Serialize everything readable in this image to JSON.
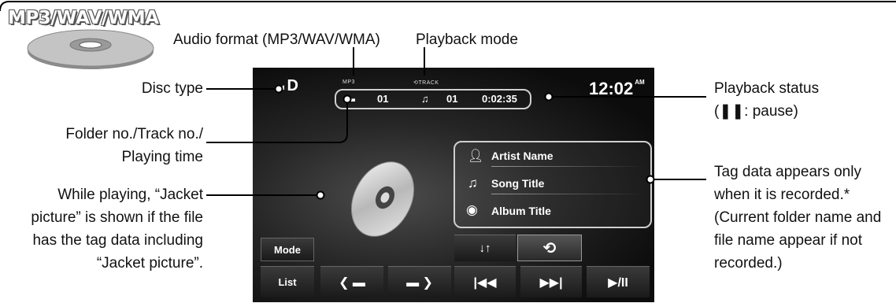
{
  "header": {
    "format_title": "MP3/WAV/WMA"
  },
  "callouts": {
    "audio_format": "Audio format (MP3/WAV/WMA)",
    "playback_mode": "Playback mode",
    "disc_type": "Disc type",
    "folder_track_1": "Folder no./Track no./",
    "folder_track_2": "Playing time",
    "jacket_1": "While playing, “Jacket",
    "jacket_2": "picture” is shown if the file",
    "jacket_3": "has the tag data including",
    "jacket_4": "“Jacket picture”.",
    "status_1": "Playback status",
    "status_2": "(❚❚: pause)",
    "tag_1": "Tag data appears only",
    "tag_2": "when it is recorded.*",
    "tag_3": "(Current folder name and",
    "tag_4": "file name appear if not",
    "tag_5": "recorded.)"
  },
  "screen": {
    "disc_label": "D",
    "format_small": "MP3",
    "mode_small": "TRACK",
    "clock": "12:02",
    "clock_ampm": "AM",
    "folder_no": "01",
    "track_no": "01",
    "playing_time": "0:02:35",
    "tags": [
      "Artist Name",
      "Song Title",
      "Album Title"
    ],
    "buttons": {
      "mode": "Mode",
      "list": "List",
      "play_pause": "▶/II"
    }
  }
}
